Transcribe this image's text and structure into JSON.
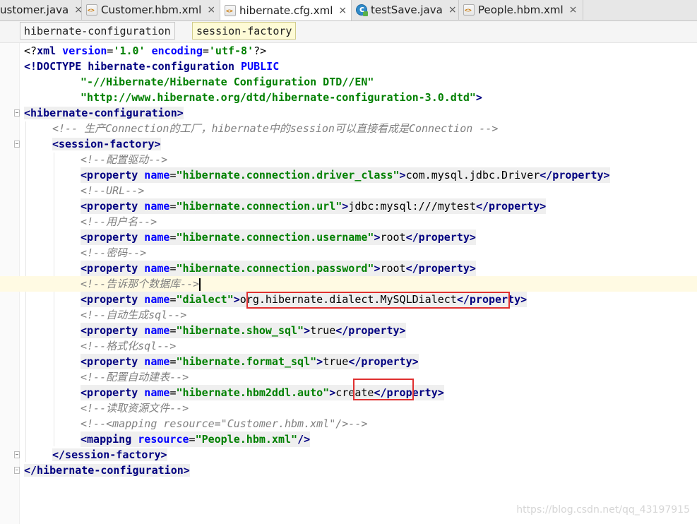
{
  "tabs": [
    {
      "label": "ustomer.java",
      "icon": "java-class-icon",
      "active": false
    },
    {
      "label": "Customer.hbm.xml",
      "icon": "xml-file-icon",
      "active": false
    },
    {
      "label": "hibernate.cfg.xml",
      "icon": "xml-file-icon",
      "active": true
    },
    {
      "label": "testSave.java",
      "icon": "java-class-icon",
      "active": false
    },
    {
      "label": "People.hbm.xml",
      "icon": "xml-file-icon",
      "active": false
    }
  ],
  "close_glyph": "×",
  "breadcrumb": [
    "hibernate-configuration",
    "session-factory"
  ],
  "code": {
    "l1": {
      "p1": "<?",
      "t1": "xml",
      "a1": " version",
      "p2": "=",
      "v1": "'1.0'",
      "a2": " encoding",
      "p3": "=",
      "v2": "'utf-8'",
      "p4": "?>"
    },
    "l2": {
      "t1": "<!DOCTYPE hibernate-configuration",
      "a1": " PUBLIC"
    },
    "l3": {
      "v1": "\"-//Hibernate/Hibernate Configuration DTD//EN\""
    },
    "l4": {
      "v1": "\"http://www.hibernate.org/dtd/hibernate-configuration-3.0.dtd\"",
      "t1": ">"
    },
    "l5": {
      "t1": "<hibernate-configuration>"
    },
    "l6": {
      "c1": "<!-- 生产Connection的工厂，hibernate中的session可以直接看成是Connection -->"
    },
    "l7": {
      "t1": "<session-factory>"
    },
    "l8": {
      "c1": "<!--配置驱动-->"
    },
    "l9": {
      "t1": "<property",
      "a1": " name",
      "p1": "=",
      "v1": "\"hibernate.connection.driver_class\"",
      "t2": ">",
      "x1": "com.mysql.jdbc.Driver",
      "t3": "</property>"
    },
    "l10": {
      "c1": "<!--URL-->"
    },
    "l11": {
      "t1": "<property",
      "a1": " name",
      "p1": "=",
      "v1": "\"hibernate.connection.url\"",
      "t2": ">",
      "x1": "jdbc:mysql:///mytest",
      "t3": "</property>"
    },
    "l12": {
      "c1": "<!--用户名-->"
    },
    "l13": {
      "t1": "<property",
      "a1": " name",
      "p1": "=",
      "v1": "\"hibernate.connection.username\"",
      "t2": ">",
      "x1": "root",
      "t3": "</property>"
    },
    "l14": {
      "c1": "<!--密码-->"
    },
    "l15": {
      "t1": "<property",
      "a1": " name",
      "p1": "=",
      "v1": "\"hibernate.connection.password\"",
      "t2": ">",
      "x1": "root",
      "t3": "</property>"
    },
    "l16": {
      "c1": "<!--告诉那个数据库-->"
    },
    "l17": {
      "t1": "<property",
      "a1": " name",
      "p1": "=",
      "v1": "\"dialect\"",
      "t2": ">",
      "x1": "org.hibernate.dialect.MySQLDialect",
      "t3": "</property>"
    },
    "l18": {
      "c1": "<!--自动生成sql-->"
    },
    "l19": {
      "t1": "<property",
      "a1": " name",
      "p1": "=",
      "v1": "\"hibernate.show_sql\"",
      "t2": ">",
      "x1": "true",
      "t3": "</property>"
    },
    "l20": {
      "c1": "<!--格式化sql-->"
    },
    "l21": {
      "t1": "<property",
      "a1": " name",
      "p1": "=",
      "v1": "\"hibernate.format_sql\"",
      "t2": ">",
      "x1": "true",
      "t3": "</property>"
    },
    "l22": {
      "c1": "<!--配置自动建表-->"
    },
    "l23": {
      "t1": "<property",
      "a1": " name",
      "p1": "=",
      "v1": "\"hibernate.hbm2ddl.auto\"",
      "t2": ">",
      "x1": "create",
      "t3": "</property>"
    },
    "l24": {
      "c1": "<!--读取资源文件-->"
    },
    "l25": {
      "c1": "<!--<mapping resource=\"Customer.hbm.xml\"/>-->"
    },
    "l26": {
      "t1": "<mapping",
      "a1": " resource",
      "p1": "=",
      "v1": "\"People.hbm.xml\"",
      "t2": "/>"
    },
    "l27": {
      "t1": "</session-factory>"
    },
    "l28": {
      "t1": "</hibernate-configuration>"
    }
  },
  "watermark": "https://blog.csdn.net/qq_43197915",
  "colors": {
    "tag": "#000080",
    "attribute": "#0000ff",
    "value": "#008000",
    "comment": "#808080",
    "highlight_box": "#e03030",
    "caret_line": "#fffae3"
  }
}
